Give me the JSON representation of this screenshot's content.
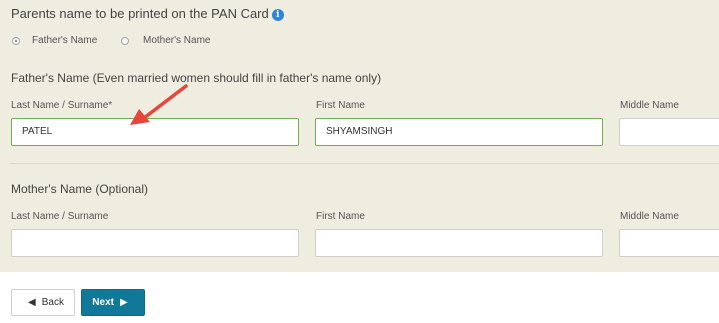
{
  "parents": {
    "title": "Parents name to be printed on the PAN Card",
    "info_icon": "i",
    "options": [
      {
        "label": "Father's Name",
        "checked": true
      },
      {
        "label": "Mother's Name",
        "checked": false
      }
    ]
  },
  "father": {
    "title": "Father's Name (Even married women should fill in father's name only)",
    "last_label": "Last Name / Surname*",
    "last_value": "PATEL",
    "first_label": "First Name",
    "first_value": "SHYAMSINGH",
    "middle_label": "Middle Name",
    "middle_value": ""
  },
  "mother": {
    "title": "Mother's Name (Optional)",
    "last_label": "Last Name / Surname",
    "last_value": "",
    "first_label": "First Name",
    "first_value": "",
    "middle_label": "Middle Name",
    "middle_value": ""
  },
  "buttons": {
    "back_label": "Back",
    "back_icon": "left-arrow-icon",
    "next_label": "Next",
    "next_icon": "right-arrow-icon"
  },
  "annotation": {
    "icon": "red-pointer-arrow-icon",
    "color": "#e8453c"
  }
}
